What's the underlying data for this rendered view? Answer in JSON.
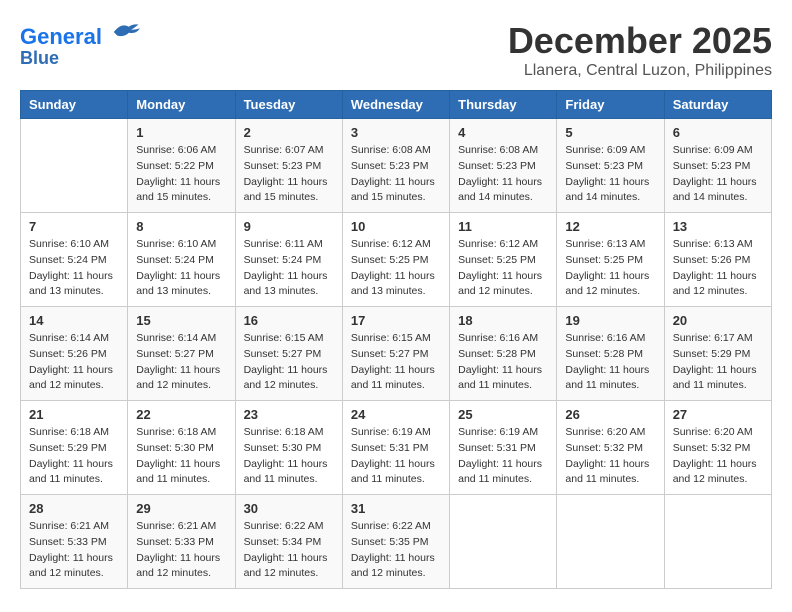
{
  "header": {
    "logo_line1": "General",
    "logo_line2": "Blue",
    "month": "December 2025",
    "location": "Llanera, Central Luzon, Philippines"
  },
  "days_of_week": [
    "Sunday",
    "Monday",
    "Tuesday",
    "Wednesday",
    "Thursday",
    "Friday",
    "Saturday"
  ],
  "weeks": [
    [
      {
        "num": "",
        "sunrise": "",
        "sunset": "",
        "daylight": ""
      },
      {
        "num": "1",
        "sunrise": "Sunrise: 6:06 AM",
        "sunset": "Sunset: 5:22 PM",
        "daylight": "Daylight: 11 hours and 15 minutes."
      },
      {
        "num": "2",
        "sunrise": "Sunrise: 6:07 AM",
        "sunset": "Sunset: 5:23 PM",
        "daylight": "Daylight: 11 hours and 15 minutes."
      },
      {
        "num": "3",
        "sunrise": "Sunrise: 6:08 AM",
        "sunset": "Sunset: 5:23 PM",
        "daylight": "Daylight: 11 hours and 15 minutes."
      },
      {
        "num": "4",
        "sunrise": "Sunrise: 6:08 AM",
        "sunset": "Sunset: 5:23 PM",
        "daylight": "Daylight: 11 hours and 14 minutes."
      },
      {
        "num": "5",
        "sunrise": "Sunrise: 6:09 AM",
        "sunset": "Sunset: 5:23 PM",
        "daylight": "Daylight: 11 hours and 14 minutes."
      },
      {
        "num": "6",
        "sunrise": "Sunrise: 6:09 AM",
        "sunset": "Sunset: 5:23 PM",
        "daylight": "Daylight: 11 hours and 14 minutes."
      }
    ],
    [
      {
        "num": "7",
        "sunrise": "Sunrise: 6:10 AM",
        "sunset": "Sunset: 5:24 PM",
        "daylight": "Daylight: 11 hours and 13 minutes."
      },
      {
        "num": "8",
        "sunrise": "Sunrise: 6:10 AM",
        "sunset": "Sunset: 5:24 PM",
        "daylight": "Daylight: 11 hours and 13 minutes."
      },
      {
        "num": "9",
        "sunrise": "Sunrise: 6:11 AM",
        "sunset": "Sunset: 5:24 PM",
        "daylight": "Daylight: 11 hours and 13 minutes."
      },
      {
        "num": "10",
        "sunrise": "Sunrise: 6:12 AM",
        "sunset": "Sunset: 5:25 PM",
        "daylight": "Daylight: 11 hours and 13 minutes."
      },
      {
        "num": "11",
        "sunrise": "Sunrise: 6:12 AM",
        "sunset": "Sunset: 5:25 PM",
        "daylight": "Daylight: 11 hours and 12 minutes."
      },
      {
        "num": "12",
        "sunrise": "Sunrise: 6:13 AM",
        "sunset": "Sunset: 5:25 PM",
        "daylight": "Daylight: 11 hours and 12 minutes."
      },
      {
        "num": "13",
        "sunrise": "Sunrise: 6:13 AM",
        "sunset": "Sunset: 5:26 PM",
        "daylight": "Daylight: 11 hours and 12 minutes."
      }
    ],
    [
      {
        "num": "14",
        "sunrise": "Sunrise: 6:14 AM",
        "sunset": "Sunset: 5:26 PM",
        "daylight": "Daylight: 11 hours and 12 minutes."
      },
      {
        "num": "15",
        "sunrise": "Sunrise: 6:14 AM",
        "sunset": "Sunset: 5:27 PM",
        "daylight": "Daylight: 11 hours and 12 minutes."
      },
      {
        "num": "16",
        "sunrise": "Sunrise: 6:15 AM",
        "sunset": "Sunset: 5:27 PM",
        "daylight": "Daylight: 11 hours and 12 minutes."
      },
      {
        "num": "17",
        "sunrise": "Sunrise: 6:15 AM",
        "sunset": "Sunset: 5:27 PM",
        "daylight": "Daylight: 11 hours and 11 minutes."
      },
      {
        "num": "18",
        "sunrise": "Sunrise: 6:16 AM",
        "sunset": "Sunset: 5:28 PM",
        "daylight": "Daylight: 11 hours and 11 minutes."
      },
      {
        "num": "19",
        "sunrise": "Sunrise: 6:16 AM",
        "sunset": "Sunset: 5:28 PM",
        "daylight": "Daylight: 11 hours and 11 minutes."
      },
      {
        "num": "20",
        "sunrise": "Sunrise: 6:17 AM",
        "sunset": "Sunset: 5:29 PM",
        "daylight": "Daylight: 11 hours and 11 minutes."
      }
    ],
    [
      {
        "num": "21",
        "sunrise": "Sunrise: 6:18 AM",
        "sunset": "Sunset: 5:29 PM",
        "daylight": "Daylight: 11 hours and 11 minutes."
      },
      {
        "num": "22",
        "sunrise": "Sunrise: 6:18 AM",
        "sunset": "Sunset: 5:30 PM",
        "daylight": "Daylight: 11 hours and 11 minutes."
      },
      {
        "num": "23",
        "sunrise": "Sunrise: 6:18 AM",
        "sunset": "Sunset: 5:30 PM",
        "daylight": "Daylight: 11 hours and 11 minutes."
      },
      {
        "num": "24",
        "sunrise": "Sunrise: 6:19 AM",
        "sunset": "Sunset: 5:31 PM",
        "daylight": "Daylight: 11 hours and 11 minutes."
      },
      {
        "num": "25",
        "sunrise": "Sunrise: 6:19 AM",
        "sunset": "Sunset: 5:31 PM",
        "daylight": "Daylight: 11 hours and 11 minutes."
      },
      {
        "num": "26",
        "sunrise": "Sunrise: 6:20 AM",
        "sunset": "Sunset: 5:32 PM",
        "daylight": "Daylight: 11 hours and 11 minutes."
      },
      {
        "num": "27",
        "sunrise": "Sunrise: 6:20 AM",
        "sunset": "Sunset: 5:32 PM",
        "daylight": "Daylight: 11 hours and 12 minutes."
      }
    ],
    [
      {
        "num": "28",
        "sunrise": "Sunrise: 6:21 AM",
        "sunset": "Sunset: 5:33 PM",
        "daylight": "Daylight: 11 hours and 12 minutes."
      },
      {
        "num": "29",
        "sunrise": "Sunrise: 6:21 AM",
        "sunset": "Sunset: 5:33 PM",
        "daylight": "Daylight: 11 hours and 12 minutes."
      },
      {
        "num": "30",
        "sunrise": "Sunrise: 6:22 AM",
        "sunset": "Sunset: 5:34 PM",
        "daylight": "Daylight: 11 hours and 12 minutes."
      },
      {
        "num": "31",
        "sunrise": "Sunrise: 6:22 AM",
        "sunset": "Sunset: 5:35 PM",
        "daylight": "Daylight: 11 hours and 12 minutes."
      },
      {
        "num": "",
        "sunrise": "",
        "sunset": "",
        "daylight": ""
      },
      {
        "num": "",
        "sunrise": "",
        "sunset": "",
        "daylight": ""
      },
      {
        "num": "",
        "sunrise": "",
        "sunset": "",
        "daylight": ""
      }
    ]
  ]
}
